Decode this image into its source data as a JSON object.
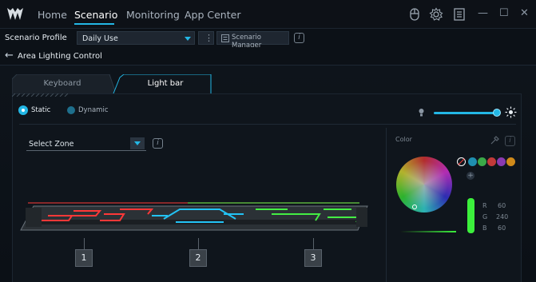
{
  "nav": {
    "home": "Home",
    "scenario": "Scenario",
    "monitoring": "Monitoring",
    "app_center": "App Center"
  },
  "profile": {
    "label": "Scenario Profile",
    "value": "Daily Use",
    "manager_label": "Scenario Manager"
  },
  "breadcrumb": {
    "title": "Area Lighting Control"
  },
  "tabs": [
    {
      "label": "Keyboard",
      "active": false
    },
    {
      "label": "Light bar",
      "active": true
    }
  ],
  "mode": {
    "static_label": "Static",
    "dynamic_label": "Dynamic",
    "selected": "Static"
  },
  "brightness": {
    "level": 1.0
  },
  "zone_select": {
    "value": "Select Zone"
  },
  "zones": [
    "1",
    "2",
    "3"
  ],
  "color": {
    "title": "Color",
    "r_label": "R",
    "r_value": "60",
    "g_label": "G",
    "g_value": "240",
    "b_label": "B",
    "b_value": "60",
    "presets": [
      "#ffffff",
      "#1f8fb0",
      "#3aa848",
      "#c23a3a",
      "#8a3ab0",
      "#d08a1a"
    ],
    "accent": "#23b7e5"
  }
}
